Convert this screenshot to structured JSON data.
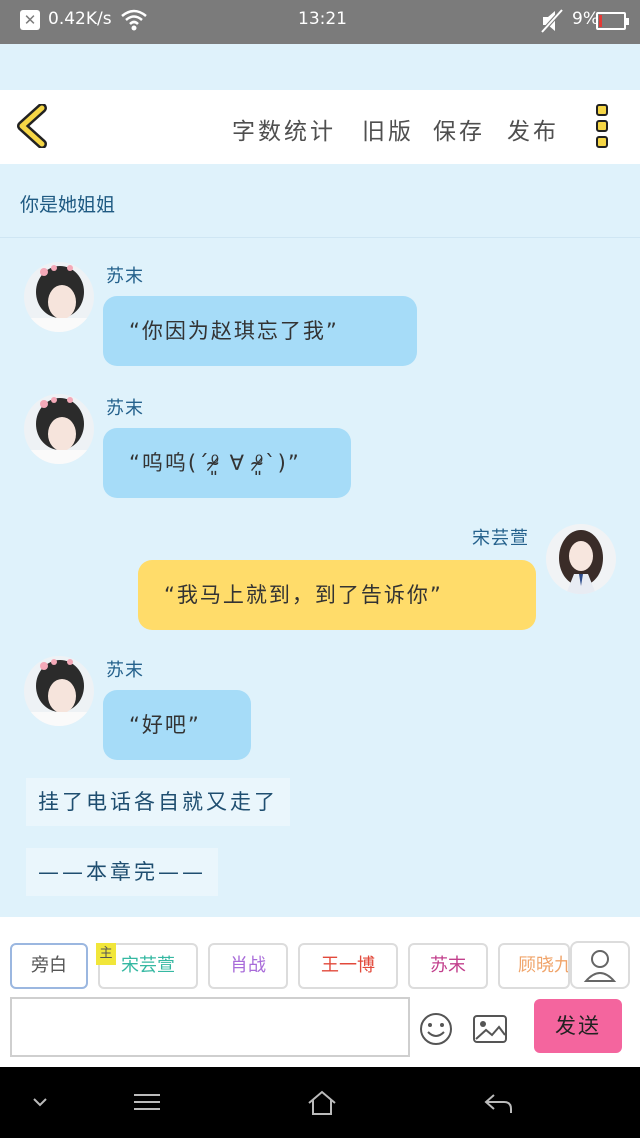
{
  "status_bar": {
    "net_speed": "0.42K/s",
    "time": "13:21",
    "battery": "9%"
  },
  "header": {
    "buttons": [
      "字数统计",
      "旧版",
      "保存",
      "发布"
    ]
  },
  "chat": {
    "narration_top": "你是她姐姐",
    "messages": [
      {
        "speaker": "苏末",
        "text": "“你因为赵琪忘了我”",
        "side": "left"
      },
      {
        "speaker": "苏末",
        "text": "“呜呜(´⁰̷̴͈ ∀ ⁰̷̴͈`)”",
        "side": "left"
      },
      {
        "speaker": "宋芸萱",
        "text": "“我马上就到，到了告诉你”",
        "side": "right"
      },
      {
        "speaker": "苏末",
        "text": "“好吧”",
        "side": "left"
      }
    ],
    "narration_1": "挂了电话各自就又走了",
    "narration_2": "——本章完——"
  },
  "bottom": {
    "roles": [
      {
        "label": "旁白",
        "color": "#555555"
      },
      {
        "label": "宋芸萱",
        "color": "#35b8a2"
      },
      {
        "label": "肖战",
        "color": "#a86bd9"
      },
      {
        "label": "王一博",
        "color": "#e2493b"
      },
      {
        "label": "苏末",
        "color": "#c23f8c"
      },
      {
        "label": "顾晓九",
        "color": "#f0a46a"
      }
    ],
    "main_tag": "主",
    "send_label": "发送",
    "input_value": ""
  },
  "icons": [
    "back-chevron-icon",
    "more-vertical-icon",
    "user-icon",
    "emoji-icon",
    "image-icon",
    "wifi-icon",
    "mute-icon",
    "menu-icon",
    "home-icon",
    "back-icon"
  ]
}
